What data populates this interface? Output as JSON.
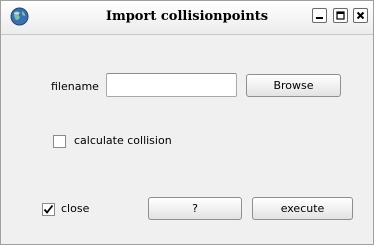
{
  "window": {
    "title": "Import collisionpoints",
    "app_icon": "globe-icon",
    "controls": [
      "minimize-icon",
      "maximize-icon",
      "close-icon"
    ]
  },
  "form": {
    "filename_label": "filename",
    "filename_value": "",
    "browse_label": "Browse",
    "calculate_collision_label": "calculate collision",
    "calculate_collision_checked": false,
    "close_label": "close",
    "close_checked": true,
    "help_label": "?",
    "execute_label": "execute"
  }
}
